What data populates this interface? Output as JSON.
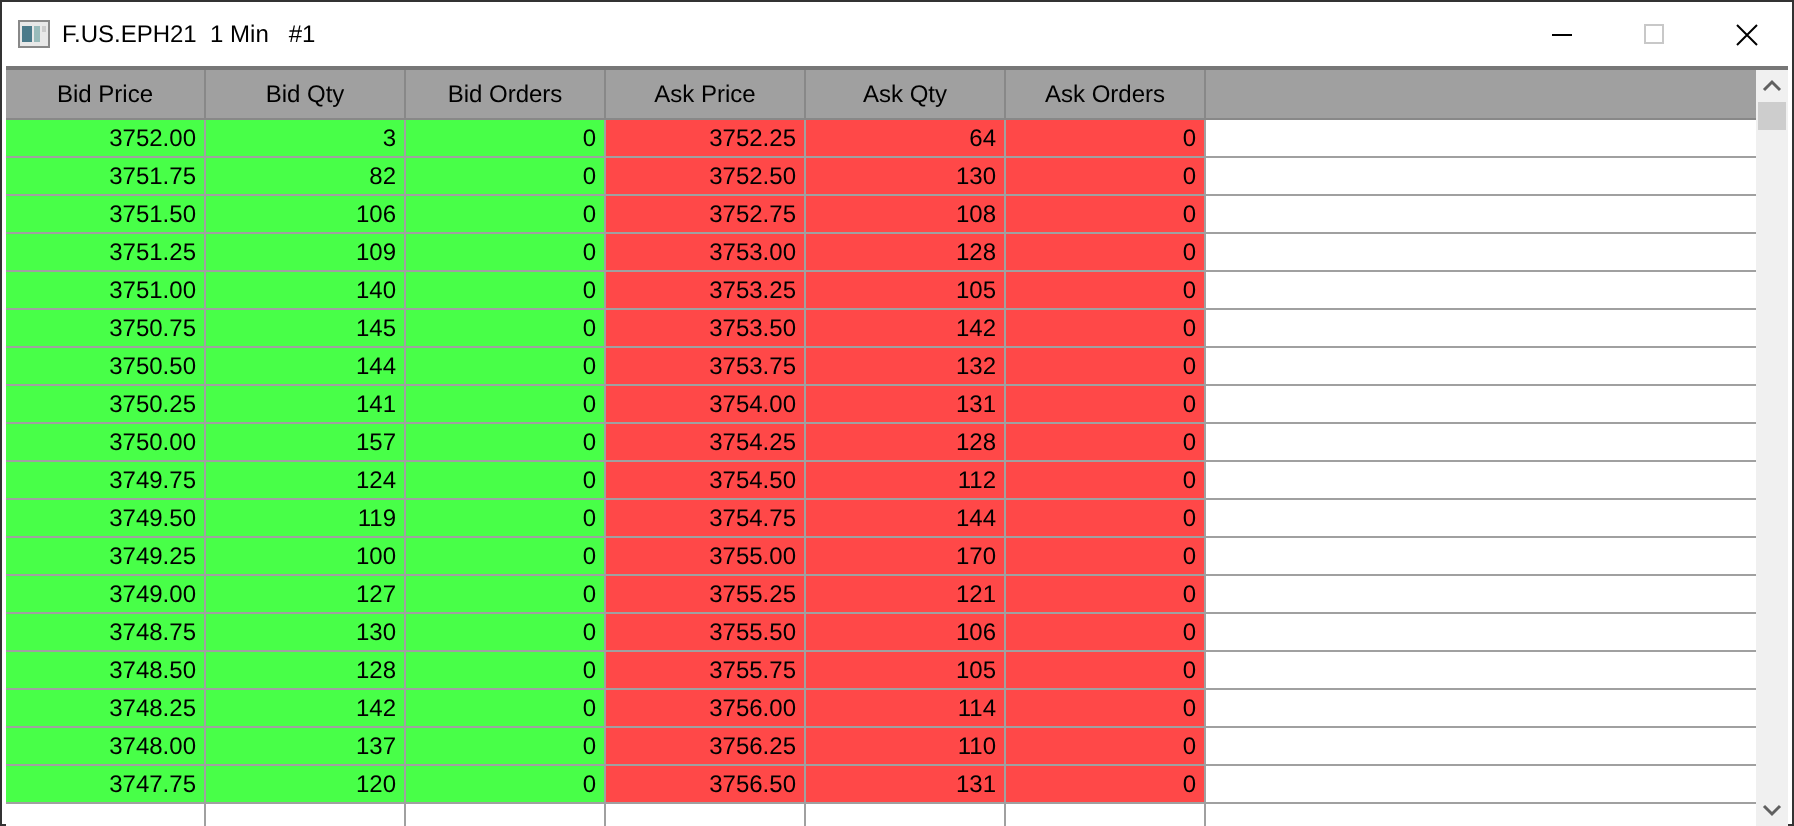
{
  "window": {
    "title": "F.US.EPH21  1 Min   #1",
    "controls": [
      {
        "kind": "minimize",
        "disabled": false
      },
      {
        "kind": "maximize",
        "disabled": true
      },
      {
        "kind": "close",
        "disabled": false
      }
    ]
  },
  "table": {
    "columns": [
      {
        "label": "Bid Price",
        "color": "#48ff48"
      },
      {
        "label": "Bid Qty",
        "color": "#48ff48"
      },
      {
        "label": "Bid Orders",
        "color": "#48ff48"
      },
      {
        "label": "Ask Price",
        "color": "#ff4848"
      },
      {
        "label": "Ask Qty",
        "color": "#ff4848"
      },
      {
        "label": "Ask Orders",
        "color": "#ff4848"
      }
    ],
    "rows": [
      [
        "3752.00",
        "3",
        "0",
        "3752.25",
        "64",
        "0"
      ],
      [
        "3751.75",
        "82",
        "0",
        "3752.50",
        "130",
        "0"
      ],
      [
        "3751.50",
        "106",
        "0",
        "3752.75",
        "108",
        "0"
      ],
      [
        "3751.25",
        "109",
        "0",
        "3753.00",
        "128",
        "0"
      ],
      [
        "3751.00",
        "140",
        "0",
        "3753.25",
        "105",
        "0"
      ],
      [
        "3750.75",
        "145",
        "0",
        "3753.50",
        "142",
        "0"
      ],
      [
        "3750.50",
        "144",
        "0",
        "3753.75",
        "132",
        "0"
      ],
      [
        "3750.25",
        "141",
        "0",
        "3754.00",
        "131",
        "0"
      ],
      [
        "3750.00",
        "157",
        "0",
        "3754.25",
        "128",
        "0"
      ],
      [
        "3749.75",
        "124",
        "0",
        "3754.50",
        "112",
        "0"
      ],
      [
        "3749.50",
        "119",
        "0",
        "3754.75",
        "144",
        "0"
      ],
      [
        "3749.25",
        "100",
        "0",
        "3755.00",
        "170",
        "0"
      ],
      [
        "3749.00",
        "127",
        "0",
        "3755.25",
        "121",
        "0"
      ],
      [
        "3748.75",
        "130",
        "0",
        "3755.50",
        "106",
        "0"
      ],
      [
        "3748.50",
        "128",
        "0",
        "3755.75",
        "105",
        "0"
      ],
      [
        "3748.25",
        "142",
        "0",
        "3756.00",
        "114",
        "0"
      ],
      [
        "3748.00",
        "137",
        "0",
        "3756.25",
        "110",
        "0"
      ],
      [
        "3747.75",
        "120",
        "0",
        "3756.50",
        "131",
        "0"
      ]
    ]
  }
}
